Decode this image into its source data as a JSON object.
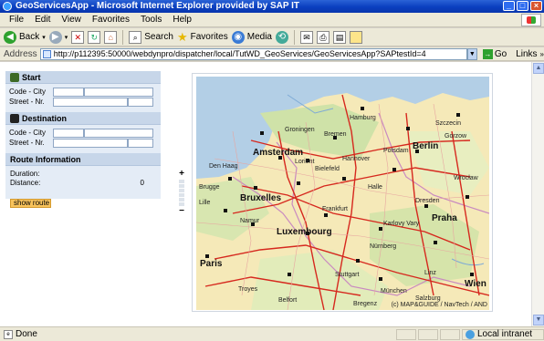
{
  "window": {
    "title": "GeoServicesApp - Microsoft Internet Explorer provided by SAP IT"
  },
  "menu": [
    "File",
    "Edit",
    "View",
    "Favorites",
    "Tools",
    "Help"
  ],
  "toolbar": {
    "back": "Back",
    "search": "Search",
    "favorites": "Favorites",
    "media": "Media"
  },
  "address": {
    "label": "Address",
    "url": "http://p112395:50000/webdynpro/dispatcher/local/TutWD_GeoServices/GeoServicesApp?SAPtestId=4",
    "go": "Go",
    "links": "Links"
  },
  "panel": {
    "start_title": "Start",
    "start_code_city": "Code - City",
    "start_street": "Street - Nr.",
    "dest_title": "Destination",
    "dest_code_city": "Code - City",
    "dest_street": "Street - Nr.",
    "route_title": "Route Information",
    "duration_label": "Duration:",
    "distance_label": "Distance:",
    "distance_value": "0",
    "show_route": "show route"
  },
  "map": {
    "cities_big": [
      "Amsterdam",
      "Berlin",
      "Bruxelles",
      "Luxembourg",
      "Paris",
      "Praha",
      "Wien"
    ],
    "cities_small": [
      "Hamburg",
      "Groningen",
      "Bremen",
      "Szczecin",
      "Den Haag",
      "Hannover",
      "Potsdam",
      "Gorzow",
      "Bielefeld",
      "Halle",
      "Wrocław",
      "Dresden",
      "Brugge",
      "Lille",
      "Namur",
      "Frankfurt",
      "Karlovy Vary",
      "Nürnberg",
      "Stuttgart",
      "München",
      "Salzburg",
      "Linz",
      "Troyes",
      "Bregenz",
      "Belfort",
      "Lorient"
    ],
    "copyright": "(c) MAP&GUIDE / NavTech / AND",
    "zoom_in": "+",
    "zoom_out": "−"
  },
  "status": {
    "text": "Done",
    "zone": "Local intranet"
  },
  "icons": [
    "ie-logo-icon",
    "back-icon",
    "forward-icon",
    "stop-icon",
    "refresh-icon",
    "home-icon",
    "search-icon",
    "favorites-star-icon",
    "media-icon",
    "history-icon",
    "mail-icon",
    "print-icon",
    "edit-icon",
    "messenger-icon",
    "page-icon",
    "go-arrow-icon",
    "start-flag-icon",
    "destination-flag-icon",
    "globe-zone-icon"
  ]
}
